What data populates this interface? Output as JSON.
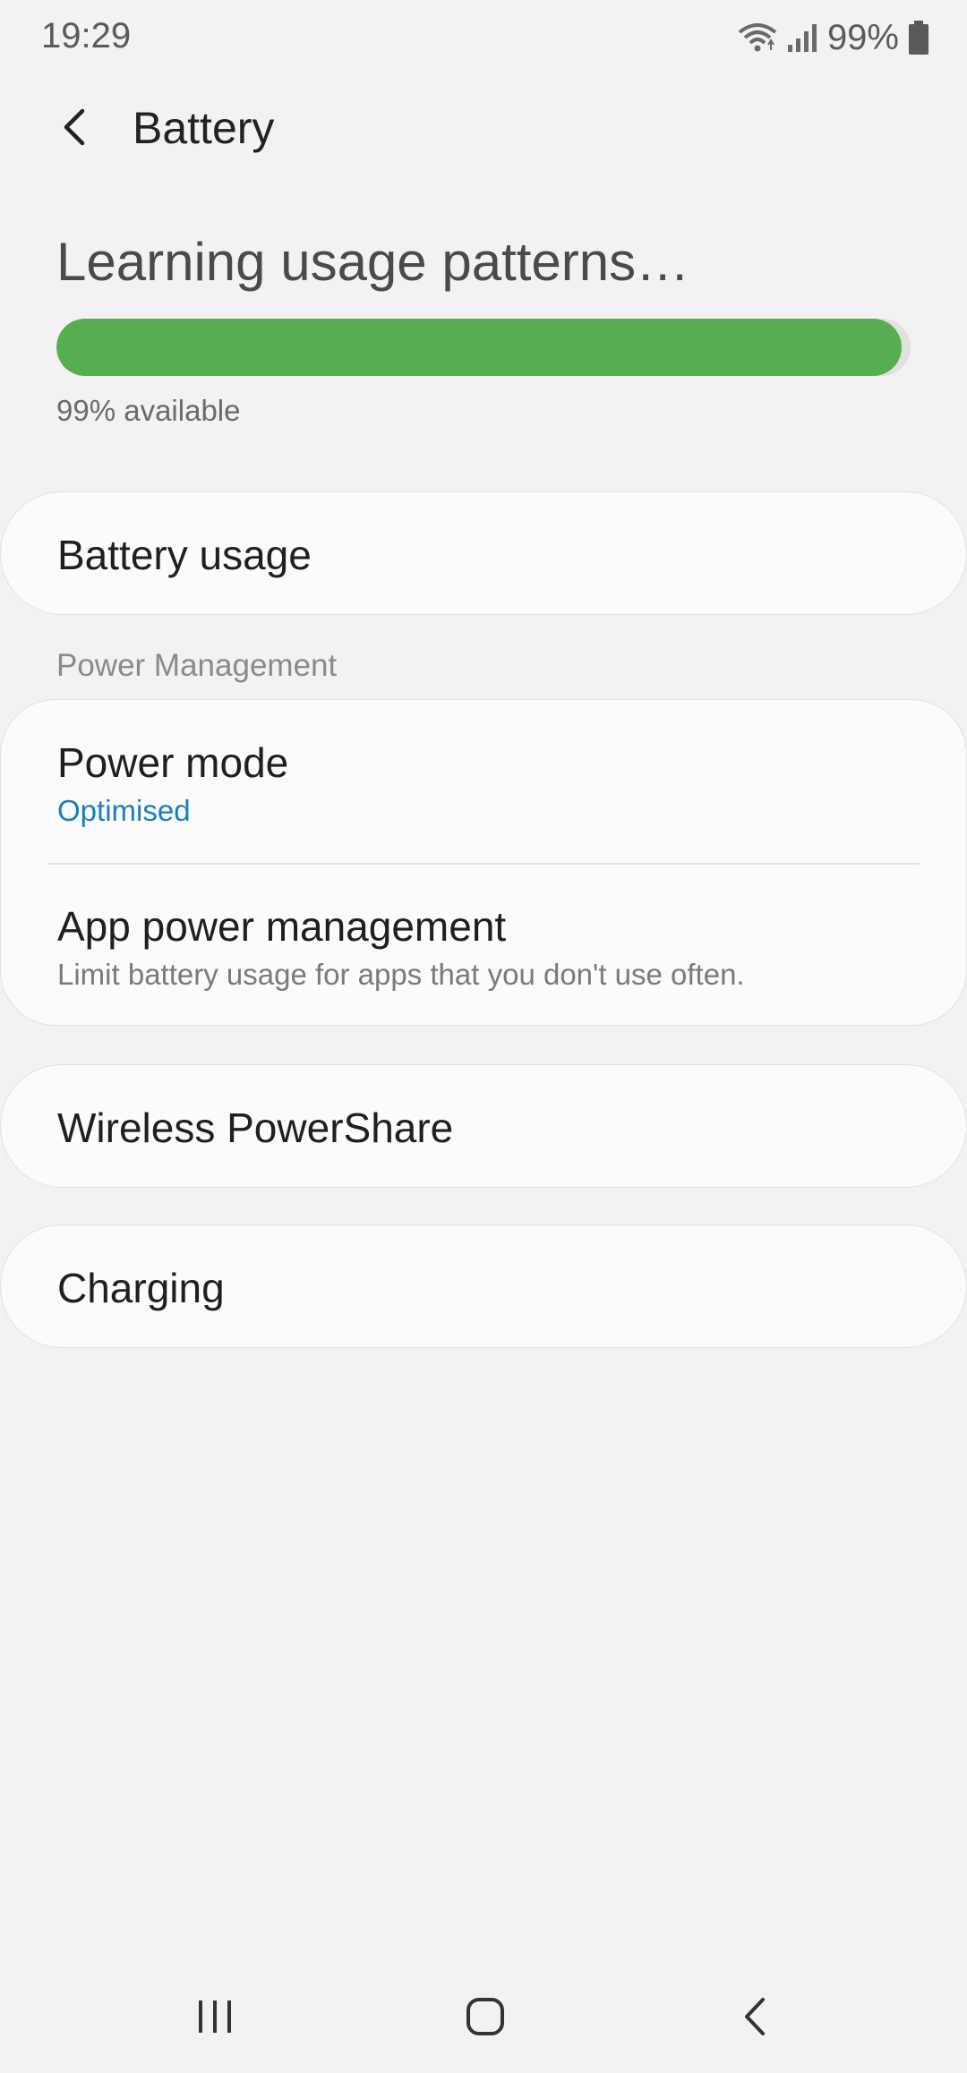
{
  "status_bar": {
    "time": "19:29",
    "battery_percent": "99%",
    "icons": [
      "wifi-icon",
      "signal-icon",
      "battery-icon"
    ]
  },
  "header": {
    "title": "Battery",
    "back_icon": "chevron-left-icon"
  },
  "battery": {
    "status_title": "Learning usage patterns…",
    "level": 0.99,
    "available_text": "99% available",
    "bar_color": "#57ae51"
  },
  "items": {
    "battery_usage": "Battery usage",
    "section_power_management": "Power Management",
    "power_mode": {
      "label": "Power mode",
      "value": "Optimised",
      "value_color": "#1a7fbf"
    },
    "app_power_management": {
      "label": "App power management",
      "description": "Limit battery usage for apps that you don't use often."
    },
    "wireless_powershare": "Wireless PowerShare",
    "charging": "Charging"
  },
  "nav_bar": {
    "icons": [
      "recent-apps-icon",
      "home-icon",
      "back-icon"
    ]
  }
}
